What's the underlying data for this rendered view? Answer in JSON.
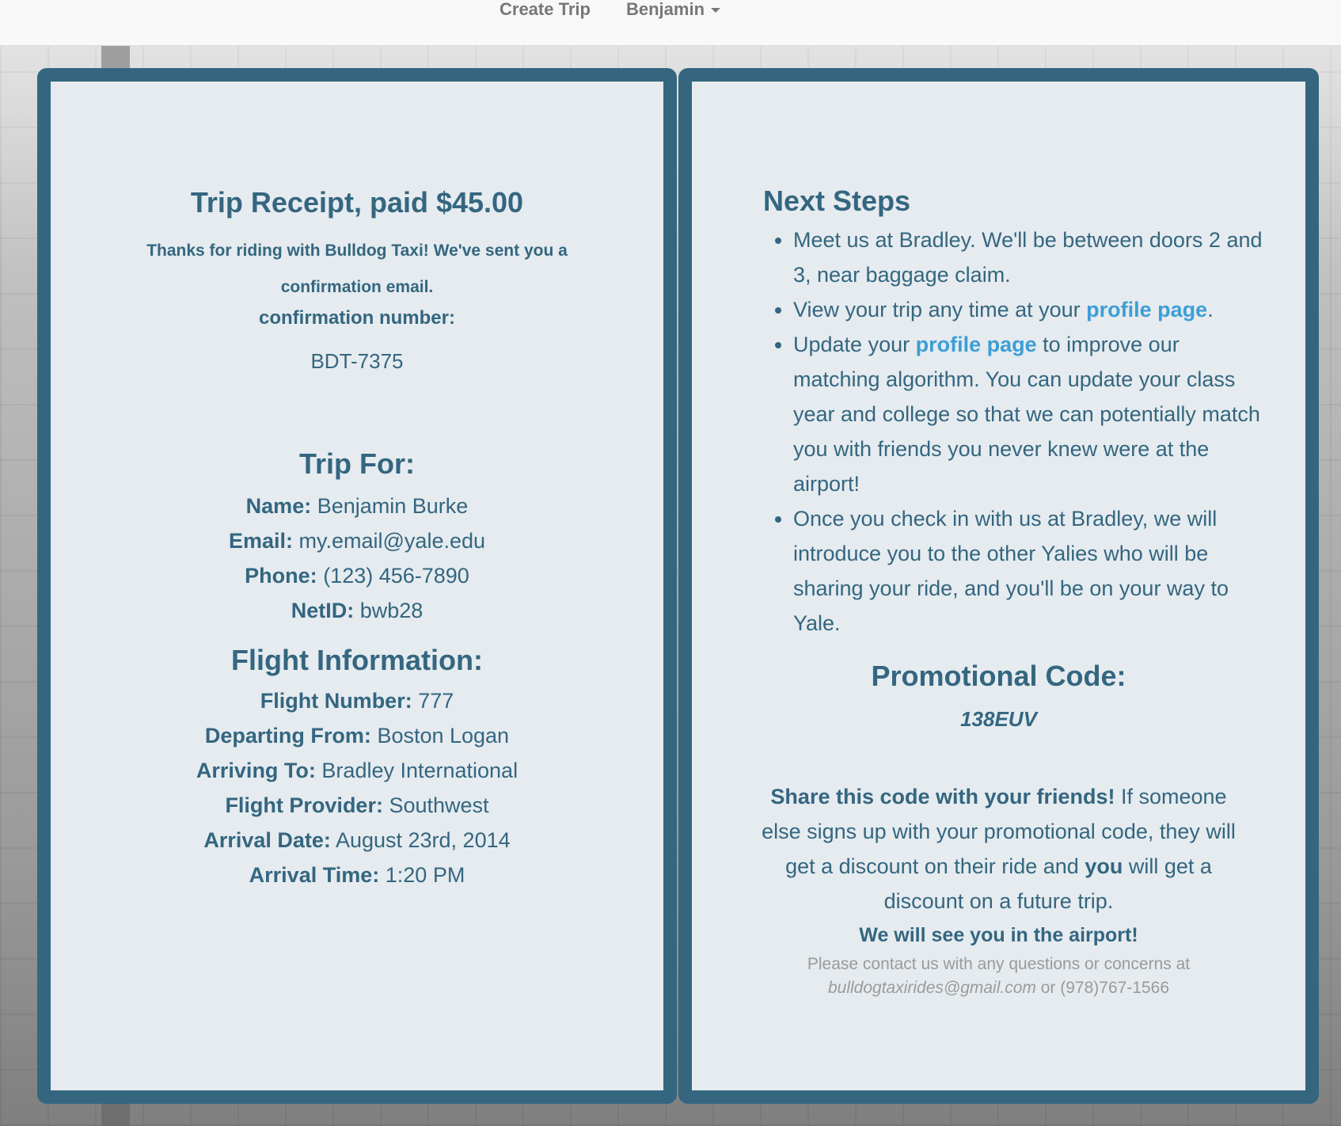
{
  "navbar": {
    "create_trip": "Create Trip",
    "user": "Benjamin"
  },
  "receipt": {
    "title": "Trip Receipt, paid $45.00",
    "thanks": "Thanks for riding with Bulldog Taxi! We've sent you a confirmation email.",
    "confirmation_label": "confirmation number:",
    "confirmation_number": "BDT-7375"
  },
  "trip_for": {
    "title": "Trip For:",
    "name_label": "Name:",
    "name": "Benjamin Burke",
    "email_label": "Email:",
    "email": "my.email@yale.edu",
    "phone_label": "Phone:",
    "phone": "(123) 456-7890",
    "netid_label": "NetID:",
    "netid": "bwb28"
  },
  "flight": {
    "title": "Flight Information:",
    "number_label": "Flight Number:",
    "number": "777",
    "from_label": "Departing From:",
    "from": "Boston Logan",
    "to_label": "Arriving To:",
    "to": "Bradley International",
    "provider_label": "Flight Provider:",
    "provider": "Southwest",
    "date_label": "Arrival Date:",
    "date": "August 23rd, 2014",
    "time_label": "Arrival Time:",
    "time": "1:20 PM"
  },
  "next_steps": {
    "title": "Next Steps",
    "step1": "Meet us at Bradley. We'll be between doors 2 and 3, near baggage claim.",
    "step2_pre": "View your trip any time at your ",
    "step2_link": "profile page",
    "step2_post": ".",
    "step3_pre": "Update your ",
    "step3_link": "profile page",
    "step3_post": " to improve our matching algorithm. You can update your class year and college so that we can potentially match you with friends you never knew were at the airport!",
    "step4": "Once you check in with us at Bradley, we will introduce you to the other Yalies who will be sharing your ride, and you'll be on your way to Yale."
  },
  "promo": {
    "title": "Promotional Code:",
    "code": "138EUV",
    "share_bold": "Share this code with your friends!",
    "share_text1": " If someone else signs up with your promotional code, they will get a discount on their ride and ",
    "share_you": "you",
    "share_text2": " will get a discount on a future trip.",
    "see_you": "We will see you in the airport!",
    "contact_pre": "Please contact us with any questions or concerns at",
    "contact_email": "bulldogtaxirides@gmail.com",
    "contact_or": " or ",
    "contact_phone": "(978)767-1566"
  },
  "colors": {
    "panel_border": "#346680",
    "text": "#346680",
    "link": "#3d9ed6"
  }
}
